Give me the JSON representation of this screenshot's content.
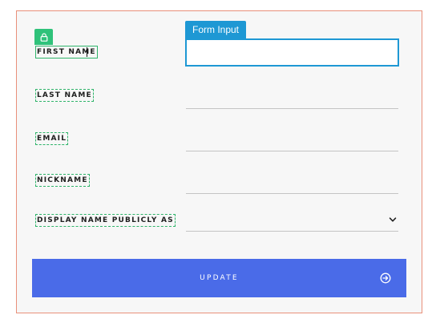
{
  "form": {
    "first_name": {
      "label": "FIRST NAME",
      "value": ""
    },
    "last_name": {
      "label": "LAST NAME",
      "value": ""
    },
    "email": {
      "label": "EMAIL",
      "value": ""
    },
    "nickname": {
      "label": "NICKNAME",
      "value": ""
    },
    "display_name": {
      "label": "DISPLAY NAME PUBLICLY AS",
      "value": ""
    }
  },
  "inspector": {
    "tag_label": "Form Input",
    "lock_icon": "lock-icon"
  },
  "update_button": {
    "label": "UPDATE",
    "icon": "arrow-right-circle-icon"
  },
  "colors": {
    "accent": "#4a6be8",
    "focus": "#1e98d4",
    "lock_badge": "#2fc27a",
    "panel_border": "#e9907a"
  }
}
